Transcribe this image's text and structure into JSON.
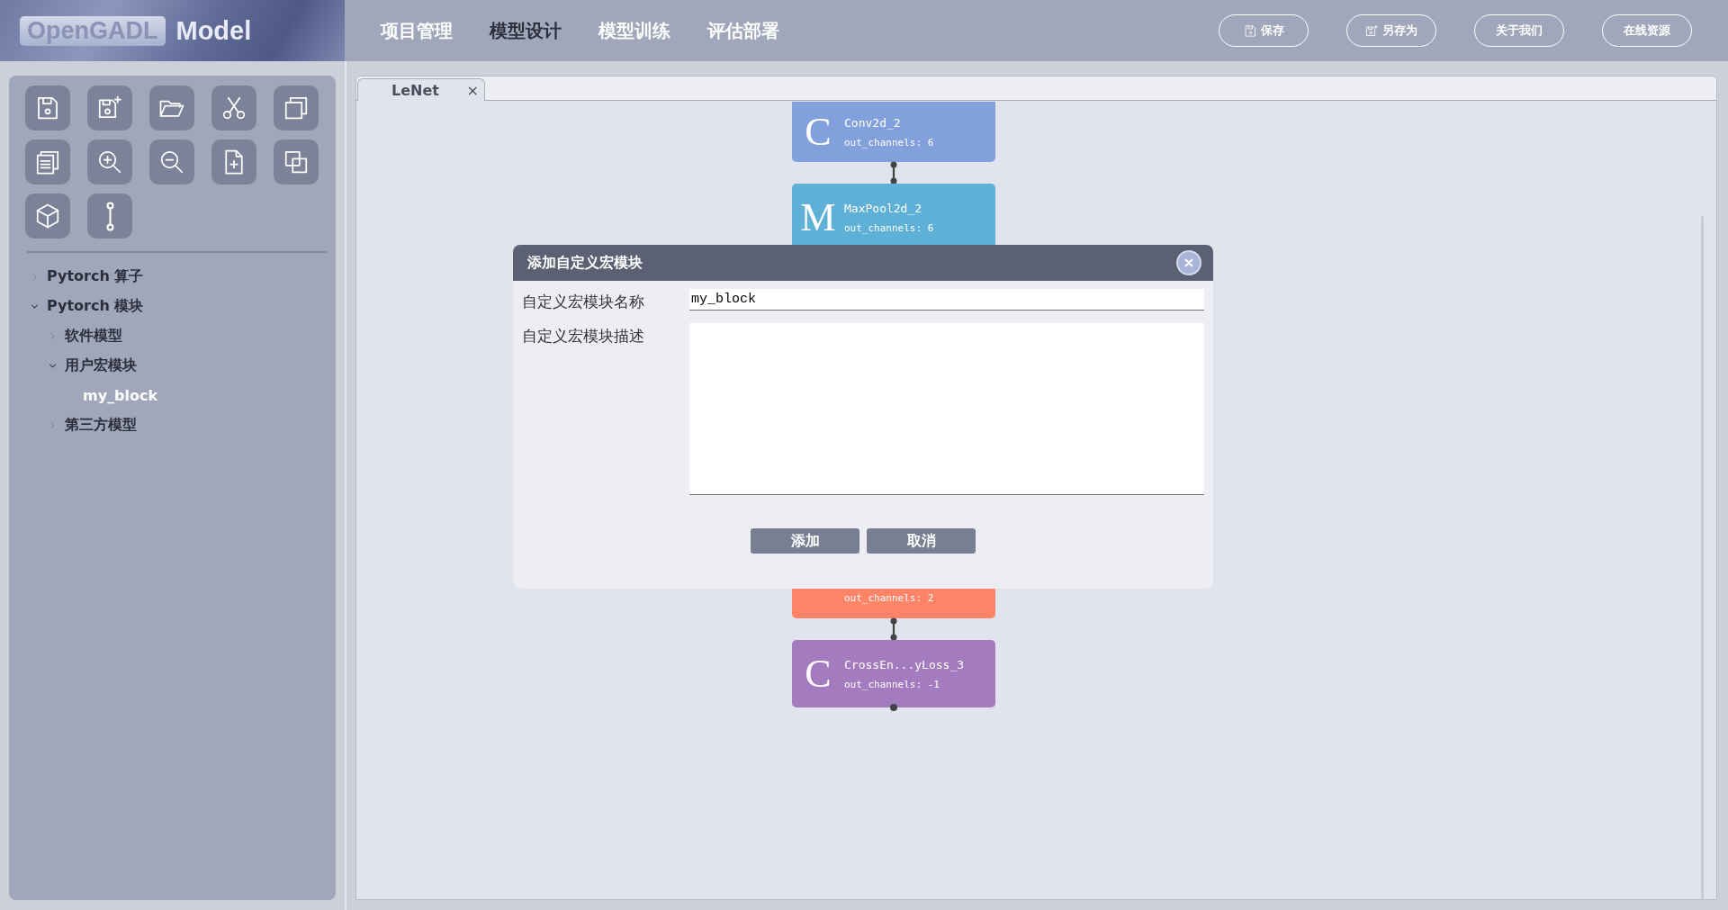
{
  "header": {
    "logo": {
      "brand": "OpenGADL",
      "product": "Model"
    },
    "nav": [
      {
        "label": "项目管理",
        "selected": false
      },
      {
        "label": "模型设计",
        "selected": true
      },
      {
        "label": "模型训练",
        "selected": false
      },
      {
        "label": "评估部署",
        "selected": false
      }
    ],
    "actions": [
      {
        "label": "保存",
        "kind": "icon"
      },
      {
        "label": "另存为",
        "kind": "icon"
      },
      {
        "label": "关于我们",
        "kind": "plain"
      },
      {
        "label": "在线资源",
        "kind": "plain"
      }
    ]
  },
  "sidebar": {
    "tree": [
      {
        "label": "Pytorch 算子",
        "expanded": false,
        "selected": false
      },
      {
        "label": "Pytorch 模块",
        "expanded": true,
        "selected": false,
        "children": [
          {
            "label": "软件模型",
            "expanded": false,
            "selected": false
          },
          {
            "label": "用户宏模块",
            "expanded": true,
            "selected": false,
            "children": [
              {
                "label": "my_block",
                "selected": true
              }
            ]
          },
          {
            "label": "第三方模型",
            "expanded": false,
            "selected": false
          }
        ]
      }
    ]
  },
  "editor": {
    "tabs": [
      {
        "label": "LeNet",
        "close": "×",
        "selected": true
      }
    ],
    "graph_top": [
      {
        "letter": "C",
        "name": "Conv2d_2",
        "detail": "out_channels: 6",
        "color": "#82a0dc"
      },
      {
        "letter": "M",
        "name": "MaxPool2d_2",
        "detail": "out_channels: 6",
        "color": "#5eb0d6"
      }
    ],
    "graph_bottom": [
      {
        "detail": "out_channels: 2",
        "color": "#fe8468"
      },
      {
        "letter": "C",
        "name": "CrossEn...yLoss_3",
        "detail": "out_channels: -1",
        "color": "#a57bbf"
      }
    ]
  },
  "dialog": {
    "title": "添加自定义宏模块",
    "fields": [
      {
        "label": "自定义宏模块名称",
        "kind": "input",
        "value": "my_block"
      },
      {
        "label": "自定义宏模块描述",
        "kind": "textarea"
      }
    ],
    "buttons": [
      "添加",
      "取消"
    ]
  }
}
